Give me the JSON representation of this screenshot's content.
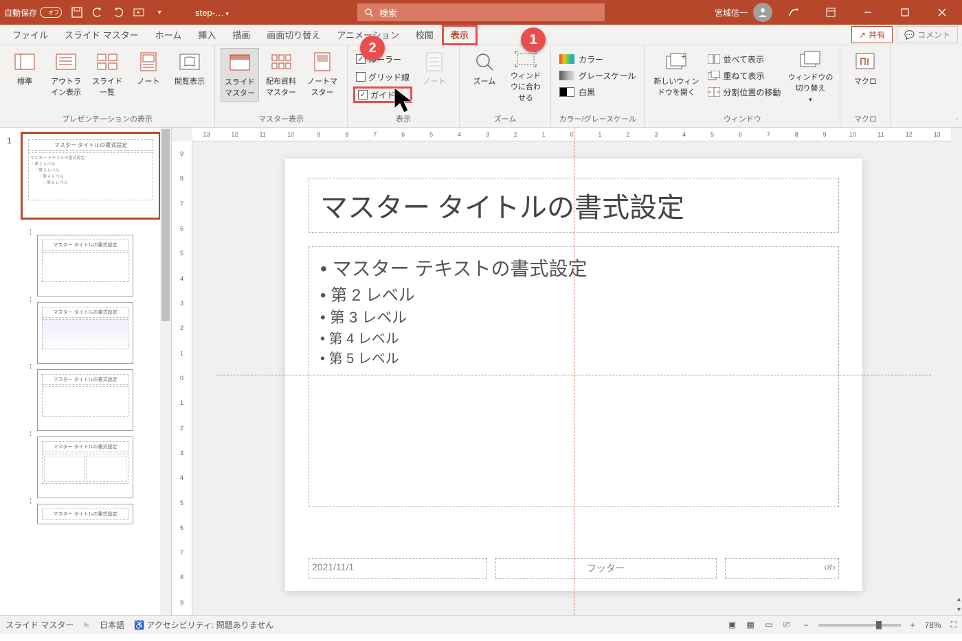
{
  "titlebar": {
    "autosave_label": "自動保存",
    "autosave_value": "オフ",
    "filename": "step-…",
    "search_placeholder": "検索",
    "username": "宮城信一"
  },
  "tabs": {
    "file": "ファイル",
    "slidemaster": "スライド マスター",
    "home": "ホーム",
    "insert": "挿入",
    "draw": "描画",
    "transitions": "画面切り替え",
    "animations": "アニメーション",
    "review": "校閲",
    "view": "表示",
    "share": "共有",
    "comments": "コメント"
  },
  "ribbon": {
    "presentation_views": {
      "label": "プレゼンテーションの表示",
      "normal": "標準",
      "outline": "アウトライン表示",
      "sorter": "スライド一覧",
      "notes_page": "ノート",
      "reading": "閲覧表示"
    },
    "master_views": {
      "label": "マスター表示",
      "slide_master": "スライドマスター",
      "handout_master": "配布資料マスター",
      "notes_master": "ノートマスター"
    },
    "show": {
      "label": "表示",
      "ruler": "ルーラー",
      "gridlines": "グリッド線",
      "guides": "ガイド",
      "notes": "ノート"
    },
    "zoom": {
      "label": "ズーム",
      "zoom": "ズーム",
      "fit": "ウィンドウに合わせる"
    },
    "color_gray": {
      "label": "カラー/グレースケール",
      "color": "カラー",
      "gray": "グレースケール",
      "bw": "白黒"
    },
    "window": {
      "label": "ウィンドウ",
      "new_window": "新しいウィンドウを開く",
      "arrange": "並べて表示",
      "cascade": "重ねて表示",
      "split": "分割位置の移動",
      "switch": "ウィンドウの切り替え"
    },
    "macros": {
      "label": "マクロ",
      "macros": "マクロ"
    }
  },
  "callouts": {
    "one": "1",
    "two": "2"
  },
  "ruler_h": [
    "13",
    "12",
    "11",
    "10",
    "9",
    "8",
    "7",
    "6",
    "5",
    "4",
    "3",
    "2",
    "1",
    "0",
    "1",
    "2",
    "3",
    "4",
    "5",
    "6",
    "7",
    "8",
    "9",
    "10",
    "11",
    "12",
    "13"
  ],
  "ruler_v": [
    "9",
    "8",
    "7",
    "6",
    "5",
    "4",
    "3",
    "2",
    "1",
    "0",
    "1",
    "2",
    "3",
    "4",
    "5",
    "6",
    "7",
    "8",
    "9"
  ],
  "slide": {
    "title": "マスター タイトルの書式設定",
    "body1": "マスター テキストの書式設定",
    "body2": "第 2 レベル",
    "body3": "第 3 レベル",
    "body4": "第 4 レベル",
    "body5": "第 5 レベル",
    "date": "2021/11/1",
    "footer": "フッター",
    "slidenum": "‹#›"
  },
  "thumbs": {
    "num": "1",
    "master_title": "マスター タイトルの書式設定",
    "master_body": "マスター テキストの書式設定\n・第 2 レベル\n　・第 3 レベル\n　　・第 4 レベル\n　　　・第 5 レベル",
    "layout_title": "マスター タイトルの書式設定"
  },
  "statusbar": {
    "mode": "スライド マスター",
    "language": "日本語",
    "accessibility": "アクセシビリティ: 問題ありません",
    "zoom": "78%"
  }
}
